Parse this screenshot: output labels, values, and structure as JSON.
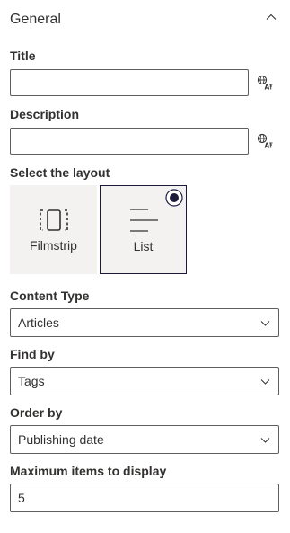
{
  "section": {
    "title": "General"
  },
  "title_field": {
    "label": "Title",
    "value": ""
  },
  "description_field": {
    "label": "Description",
    "value": ""
  },
  "layout": {
    "label": "Select the layout",
    "options": [
      {
        "label": "Filmstrip",
        "icon": "filmstrip-icon",
        "selected": false
      },
      {
        "label": "List",
        "icon": "list-icon",
        "selected": true
      }
    ]
  },
  "content_type": {
    "label": "Content Type",
    "value": "Articles"
  },
  "find_by": {
    "label": "Find by",
    "value": "Tags"
  },
  "order_by": {
    "label": "Order by",
    "value": "Publishing date"
  },
  "max_items": {
    "label": "Maximum items to display",
    "value": "5"
  },
  "colors": {
    "text": "#323130",
    "border": "#605e5c",
    "tile_background": "#f3f2f1",
    "selected_border": "#1b1a3b"
  }
}
